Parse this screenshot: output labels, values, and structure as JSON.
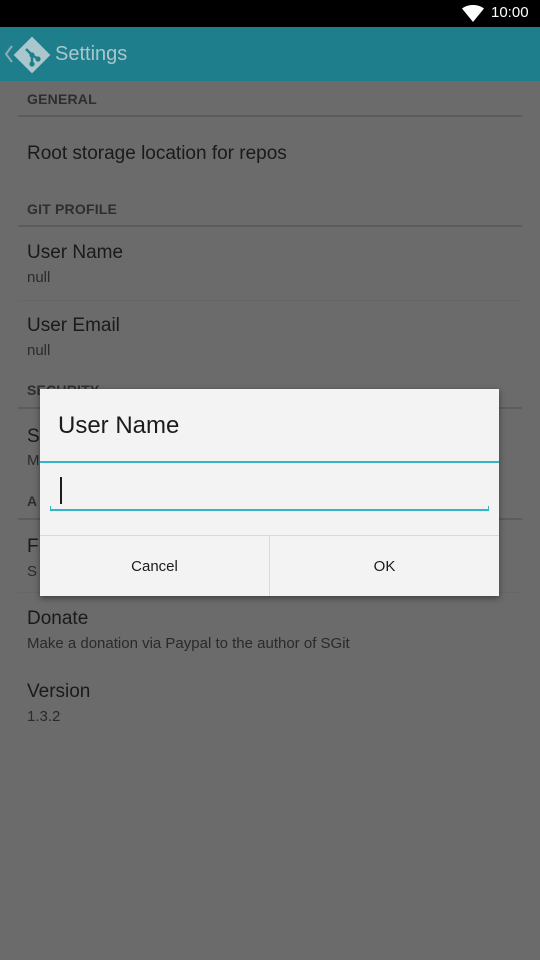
{
  "status_bar": {
    "time": "10:00",
    "wifi_icon": "wifi-icon"
  },
  "action_bar": {
    "title": "Settings",
    "logo_icon": "git-logo-icon",
    "up_icon": "chevron-left-icon"
  },
  "categories": {
    "general": "GENERAL",
    "git_profile": "GIT PROFILE",
    "security": "SECURITY",
    "about": "A"
  },
  "preferences": {
    "root_storage": {
      "title": "Root storage location for repos"
    },
    "user_name": {
      "title": "User Name",
      "summary": "null"
    },
    "user_email": {
      "title": "User Email",
      "summary": "null"
    },
    "security_item": {
      "title": "S",
      "summary": "M"
    },
    "about_item": {
      "title": "F",
      "summary": "S"
    },
    "donate": {
      "title": "Donate",
      "summary": "Make a donation via Paypal to the author of SGit"
    },
    "version": {
      "title": "Version",
      "summary": "1.3.2"
    }
  },
  "dialog": {
    "title": "User Name",
    "input_value": "",
    "input_placeholder": "",
    "cancel_label": "Cancel",
    "ok_label": "OK"
  },
  "colors": {
    "action_bar": "#1f7e8c",
    "accent": "#33b5c7",
    "scrim_background": "#6b6b6b",
    "dialog_background": "#f3f3f3"
  }
}
